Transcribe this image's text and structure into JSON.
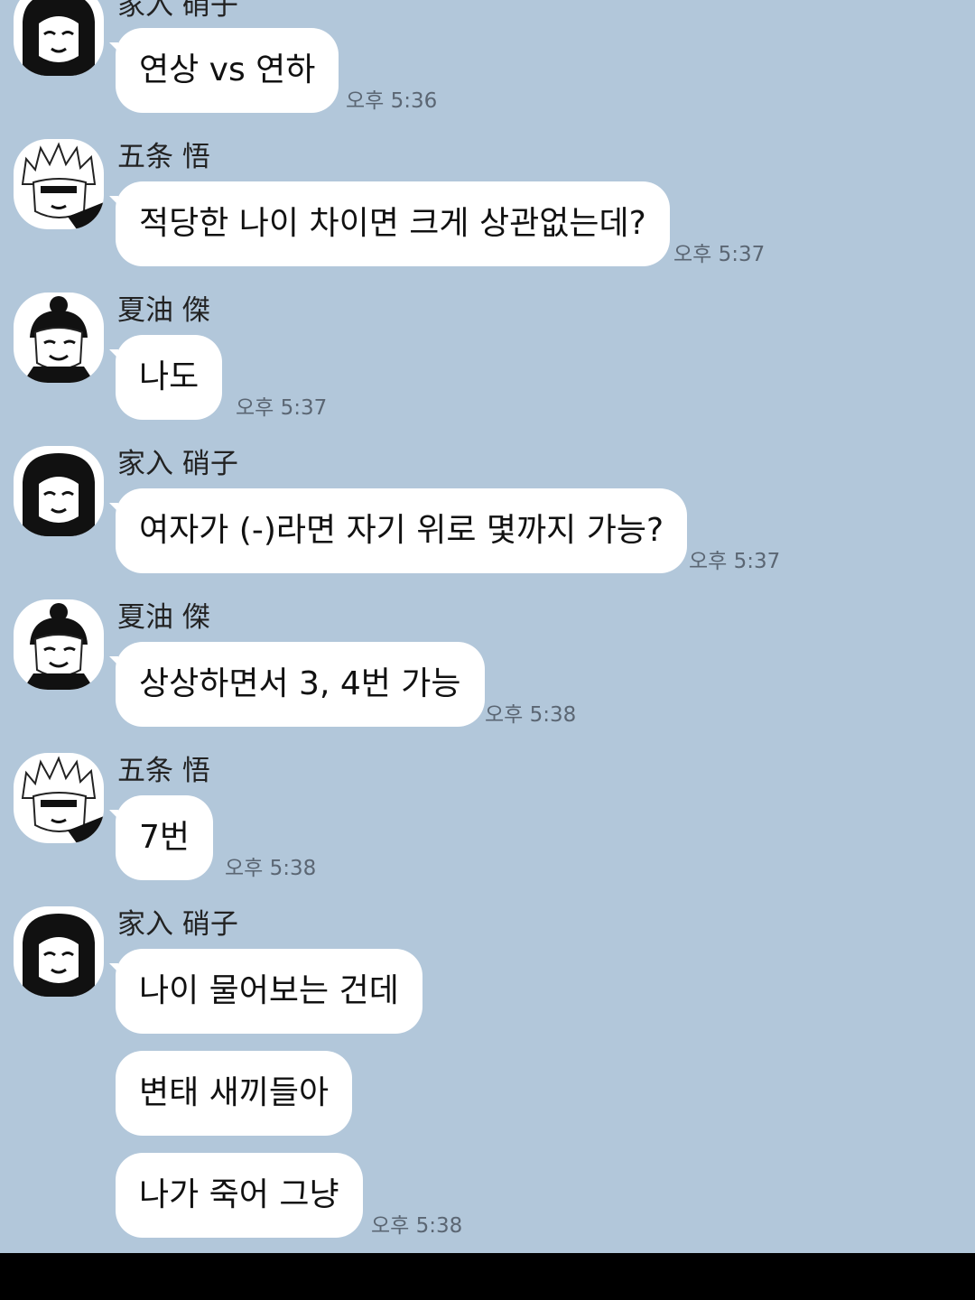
{
  "messages": [
    {
      "sender": "家入 硝子",
      "text": "연상 vs 연하",
      "time": "오후 5:36"
    },
    {
      "sender": "五条 悟",
      "text": "적당한 나이 차이면 크게 상관없는데?",
      "time": "오후 5:37"
    },
    {
      "sender": "夏油 傑",
      "text": "나도",
      "time": "오후 5:37"
    },
    {
      "sender": "家入 硝子",
      "text": "여자가 (-)라면 자기 위로 몇까지 가능?",
      "time": "오후 5:37"
    },
    {
      "sender": "夏油 傑",
      "text": "상상하면서 3, 4번 가능",
      "time": "오후 5:38"
    },
    {
      "sender": "五条 悟",
      "text": "7번",
      "time": "오후 5:38"
    },
    {
      "sender": "家入 硝子",
      "text": "나이 물어보는 건데"
    },
    {
      "text": "변태 새끼들아"
    },
    {
      "text": "나가 죽어 그냥",
      "time": "오후 5:38"
    }
  ],
  "avatars": {
    "shoko": "shoko-avatar-icon",
    "gojo": "gojo-avatar-icon",
    "geto": "geto-avatar-icon"
  },
  "colors": {
    "background": "#b2c7da",
    "bubble": "#ffffff",
    "bottom_bar": "#000000"
  }
}
